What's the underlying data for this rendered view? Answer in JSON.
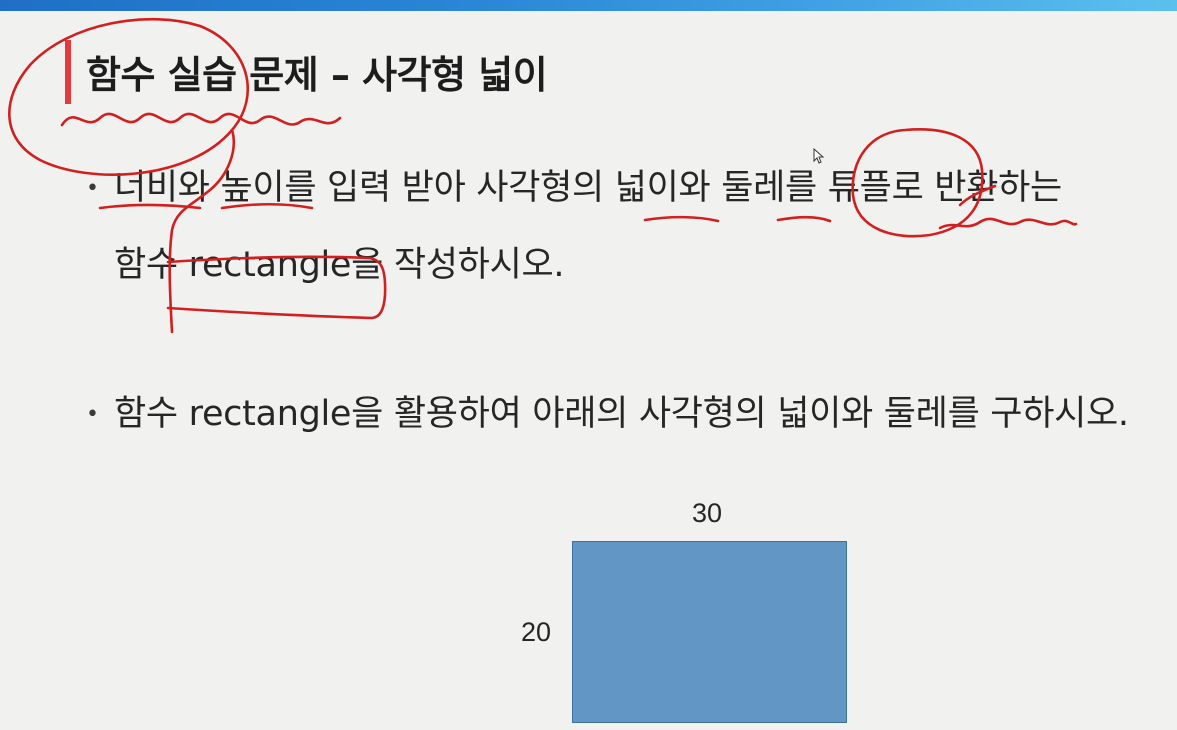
{
  "slide": {
    "title": "함수 실습 문제 – 사각형 넓이",
    "bullets": [
      {
        "line1": "너비와 높이를 입력 받아 사각형의 넓이와 둘레를 튜플로 반환하는",
        "line2": "함수 rectangle을 작성하시오."
      },
      {
        "line1": "함수 rectangle을 활용하여 아래의 사각형의 넓이와 둘레를 구하시오."
      }
    ],
    "bullet_symbol": "•",
    "figure": {
      "width_label": "30",
      "height_label": "20",
      "fill_color": "#6196c5"
    }
  },
  "theme": {
    "accent": "#e23a3f",
    "annotation_color": "#d21f1f",
    "top_band": "#2a86d6"
  }
}
